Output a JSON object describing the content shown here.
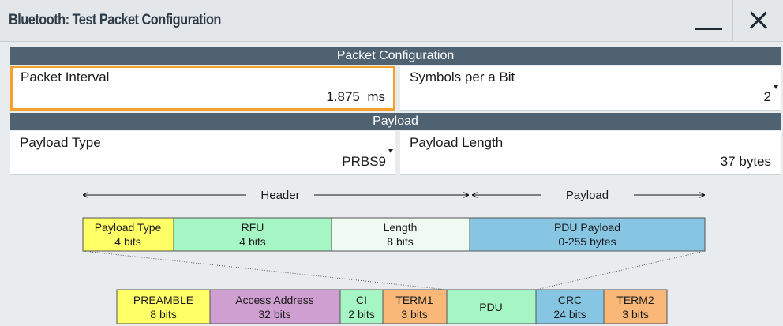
{
  "window": {
    "title": "Bluetooth: Test Packet Configuration",
    "minimize_icon": "minimize-icon",
    "close_icon": "close-icon"
  },
  "packet_configuration": {
    "header": "Packet Configuration",
    "packet_interval": {
      "label": "Packet Interval",
      "value": "1.875",
      "unit": "ms"
    },
    "symbols_per_bit": {
      "label": "Symbols per a Bit",
      "value": "2"
    }
  },
  "payload": {
    "header": "Payload",
    "payload_type": {
      "label": "Payload Type",
      "value": "PRBS9"
    },
    "payload_length": {
      "label": "Payload Length",
      "value": "37",
      "unit": "bytes"
    }
  },
  "diagram": {
    "header_label": "Header",
    "payload_label": "Payload",
    "pdu_fields": [
      {
        "name": "Payload Type",
        "size": "4 bits",
        "color": "#ffff66"
      },
      {
        "name": "RFU",
        "size": "4 bits",
        "color": "#a6f5c4"
      },
      {
        "name": "Length",
        "size": "8 bits",
        "color": "#effbf2"
      },
      {
        "name": "PDU Payload",
        "size": "0-255 bytes",
        "color": "#87c6e3"
      }
    ],
    "packet_fields": [
      {
        "name": "PREAMBLE",
        "size": "8 bits",
        "color": "#ffff66"
      },
      {
        "name": "Access Address",
        "size": "32 bits",
        "color": "#cf9fd2"
      },
      {
        "name": "CI",
        "size": "2 bits",
        "color": "#a6f5c4"
      },
      {
        "name": "TERM1",
        "size": "3 bits",
        "color": "#f9b878"
      },
      {
        "name": "PDU",
        "size": "",
        "color": "#a6f5c4"
      },
      {
        "name": "CRC",
        "size": "24 bits",
        "color": "#87c6e3"
      },
      {
        "name": "TERM2",
        "size": "3 bits",
        "color": "#f9b878"
      }
    ]
  }
}
